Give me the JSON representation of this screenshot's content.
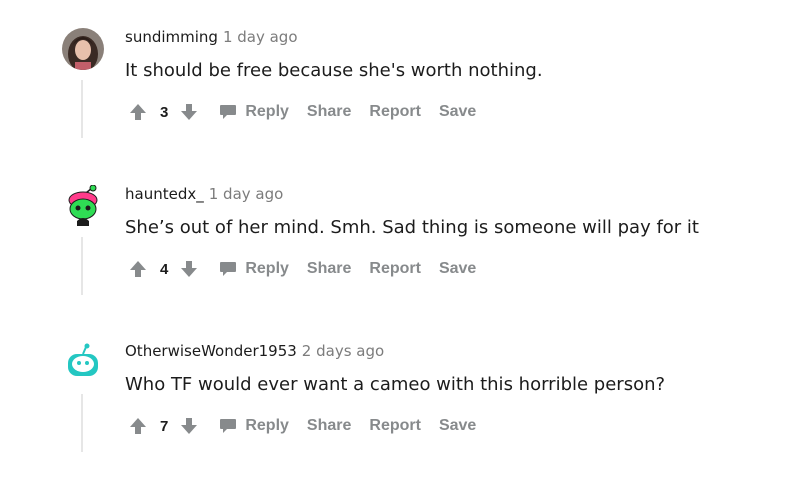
{
  "colors": {
    "text_primary": "#1c1c1c",
    "text_meta": "#7c7c7c",
    "action_gray": "#878a8c",
    "thread_line": "#e6e6e6",
    "snoo_teal": "#24c7c2",
    "snoo_pink": "#ff3b8a",
    "snoo_green": "#2fdc54"
  },
  "comments": [
    {
      "username": "sundimming",
      "timestamp": "1 day ago",
      "body": "It should be free because she's worth nothing.",
      "score": "3",
      "avatar_icon": "user-photo-avatar",
      "actions": {
        "reply": "Reply",
        "share": "Share",
        "report": "Report",
        "save": "Save"
      }
    },
    {
      "username": "hauntedx_",
      "timestamp": "1 day ago",
      "body": "She’s out of her mind. Smh. Sad thing is someone will pay for it",
      "score": "4",
      "avatar_icon": "snoo-zombie-avatar",
      "actions": {
        "reply": "Reply",
        "share": "Share",
        "report": "Report",
        "save": "Save"
      }
    },
    {
      "username": "OtherwiseWonder1953",
      "timestamp": "2 days ago",
      "body": "Who TF would ever want a cameo with this horrible person?",
      "score": "7",
      "avatar_icon": "snoo-default-avatar",
      "actions": {
        "reply": "Reply",
        "share": "Share",
        "report": "Report",
        "save": "Save"
      }
    }
  ]
}
